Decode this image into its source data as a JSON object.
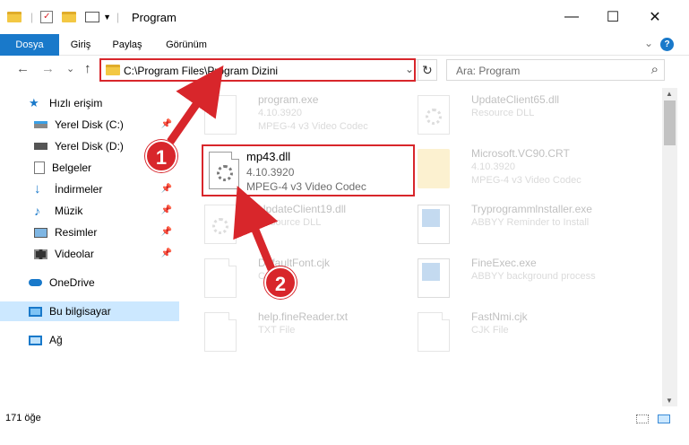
{
  "window": {
    "title": "Program",
    "minimize": "—",
    "maximize": "☐",
    "close": "✕"
  },
  "ribbon": {
    "tabs": [
      "Dosya",
      "Giriş",
      "Paylaş",
      "Görünüm"
    ],
    "expand": "⌄",
    "help": "?"
  },
  "nav": {
    "back": "←",
    "forward": "→",
    "recent": "⌄",
    "up": "↑",
    "address": "C:\\Program Files\\Program Dizini",
    "address_dropdown": "⌄",
    "refresh": "↻",
    "search_placeholder": "Ara: Program",
    "search_icon": "⌕"
  },
  "sidebar": {
    "items": [
      {
        "label": "Hızlı erişim",
        "icon": "star-icon",
        "pinned": false
      },
      {
        "label": "Yerel Disk (C:)",
        "icon": "drive-icon",
        "pinned": true
      },
      {
        "label": "Yerel Disk (D:)",
        "icon": "drive-icon",
        "pinned": true
      },
      {
        "label": "Belgeler",
        "icon": "documents-icon",
        "pinned": true
      },
      {
        "label": "İndirmeler",
        "icon": "download-icon",
        "pinned": true
      },
      {
        "label": "Müzik",
        "icon": "music-icon",
        "pinned": true
      },
      {
        "label": "Resimler",
        "icon": "pictures-icon",
        "pinned": true
      },
      {
        "label": "Videolar",
        "icon": "videos-icon",
        "pinned": true
      },
      {
        "label": "OneDrive",
        "icon": "cloud-icon",
        "pinned": false
      },
      {
        "label": "Bu bilgisayar",
        "icon": "computer-icon",
        "pinned": false
      },
      {
        "label": "Ağ",
        "icon": "network-icon",
        "pinned": false
      }
    ]
  },
  "files": [
    {
      "name": "program.exe",
      "version": "4.10.3920",
      "desc": "MPEG-4 v3 Video Codec"
    },
    {
      "name": "UpdateClient65.dll",
      "version": "",
      "desc": "Resource DLL"
    },
    {
      "name": "mp43.dll",
      "version": "4.10.3920",
      "desc": "MPEG-4 v3 Video Codec"
    },
    {
      "name": "Microsoft.VC90.CRT",
      "version": "4.10.3920",
      "desc": "MPEG-4 v3 Video Codec"
    },
    {
      "name": "UpdateClient19.dll",
      "version": "",
      "desc": "Resource DLL"
    },
    {
      "name": "Tryprogrammlnstaller.exe",
      "version": "",
      "desc": "ABBYY Reminder to Install"
    },
    {
      "name": "DefaultFont.cjk",
      "version": "",
      "desc": "CJK File"
    },
    {
      "name": "FineExec.exe",
      "version": "",
      "desc": "ABBYY background process"
    },
    {
      "name": "help.fineReader.txt",
      "version": "",
      "desc": "TXT File"
    },
    {
      "name": "FastNmi.cjk",
      "version": "",
      "desc": "CJK File"
    }
  ],
  "status": {
    "count": "171 öğe"
  },
  "annotations": {
    "step1": "1",
    "step2": "2",
    "color": "#d8262b"
  }
}
